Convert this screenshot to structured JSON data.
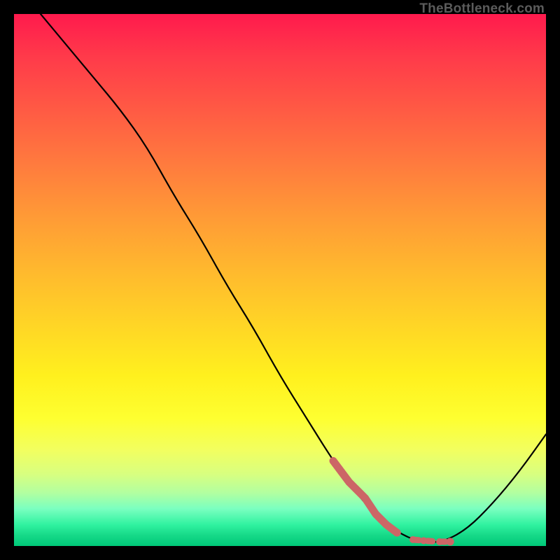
{
  "watermark": "TheBottleneck.com",
  "chart_data": {
    "type": "line",
    "title": "",
    "xlabel": "",
    "ylabel": "",
    "xlim": [
      0,
      100
    ],
    "ylim": [
      0,
      100
    ],
    "series": [
      {
        "name": "bottleneck-curve",
        "x": [
          5,
          10,
          15,
          20,
          25,
          30,
          35,
          40,
          45,
          50,
          55,
          60,
          65,
          70,
          75,
          80,
          85,
          90,
          95,
          100
        ],
        "y": [
          100,
          94,
          88,
          82,
          75,
          66,
          58,
          49,
          41,
          32,
          24,
          16,
          9,
          4,
          1,
          0.5,
          3,
          8,
          14,
          21
        ],
        "color": "#000000"
      },
      {
        "name": "highlight-segment",
        "x": [
          60,
          63,
          66,
          68,
          70,
          72,
          75,
          77,
          80,
          82
        ],
        "y": [
          16,
          12,
          9,
          6,
          4,
          2.5,
          1.2,
          1,
          0.8,
          0.8
        ],
        "color": "#cc6666"
      }
    ],
    "gradient_bg": true
  }
}
